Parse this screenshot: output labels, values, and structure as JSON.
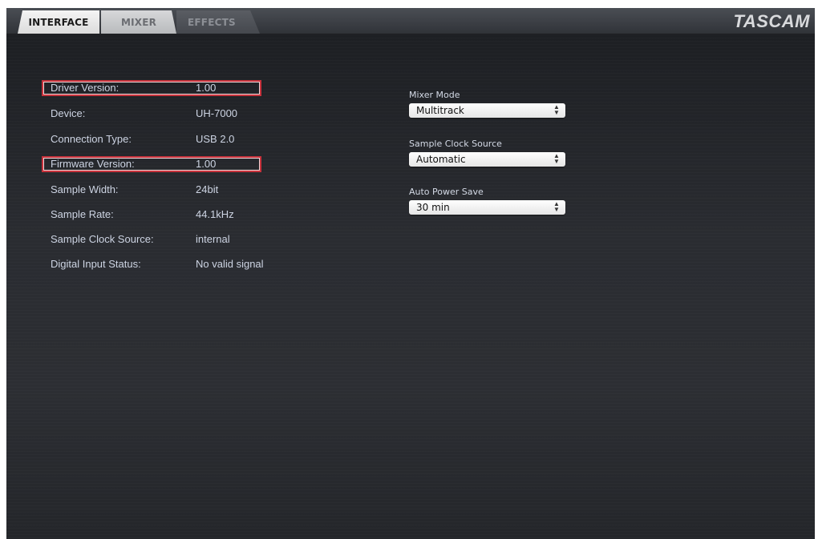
{
  "tabs": [
    {
      "label": "INTERFACE",
      "active": true
    },
    {
      "label": "MIXER",
      "active": false
    },
    {
      "label": "EFFECTS",
      "active": false
    }
  ],
  "brand": "TASCAM",
  "info": [
    {
      "label": "Driver Version:",
      "value": "1.00",
      "highlighted": true
    },
    {
      "label": "Device:",
      "value": "UH-7000",
      "highlighted": false
    },
    {
      "label": "Connection Type:",
      "value": "USB 2.0",
      "highlighted": false
    },
    {
      "label": "Firmware Version:",
      "value": "1.00",
      "highlighted": true
    },
    {
      "label": "Sample Width:",
      "value": "24bit",
      "highlighted": false
    },
    {
      "label": "Sample Rate:",
      "value": "44.1kHz",
      "highlighted": false
    },
    {
      "label": "Sample Clock Source:",
      "value": "internal",
      "highlighted": false
    },
    {
      "label": "Digital Input Status:",
      "value": "No valid signal",
      "highlighted": false
    }
  ],
  "settings": {
    "mixer_mode": {
      "label": "Mixer Mode",
      "value": "Multitrack"
    },
    "sample_clock_source": {
      "label": "Sample Clock Source",
      "value": "Automatic"
    },
    "auto_power_save": {
      "label": "Auto Power Save",
      "value": "30 min"
    }
  },
  "icons": {
    "select_arrows": "updown-chevron-icon"
  },
  "colors": {
    "highlight_border": "#c8323c",
    "panel_background": "#26282d",
    "text": "#cdd4e3"
  }
}
